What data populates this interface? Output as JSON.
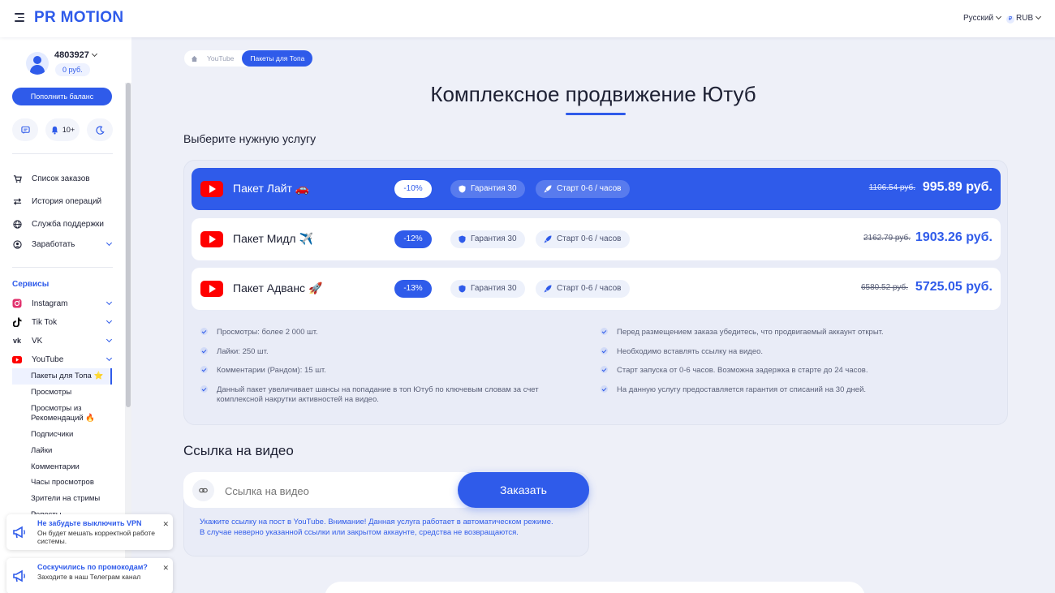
{
  "header": {
    "logo": "PR MOTION",
    "language": "Русский",
    "currency_symbol": "₽",
    "currency": "RUB"
  },
  "user": {
    "id": "4803927",
    "balance": "0 руб.",
    "topup_label": "Пополнить баланс",
    "notifications": "10+"
  },
  "sidebar": {
    "nav": [
      {
        "label": "Список заказов",
        "icon": "cart-icon"
      },
      {
        "label": "История операций",
        "icon": "transfer-icon"
      },
      {
        "label": "Служба поддержки",
        "icon": "globe-icon"
      },
      {
        "label": "Заработать",
        "icon": "user-circle-icon"
      }
    ],
    "services_title": "Сервисы",
    "services": [
      {
        "label": "Instagram",
        "icon": "instagram-icon"
      },
      {
        "label": "Tik Tok",
        "icon": "tiktok-icon"
      },
      {
        "label": "VK",
        "icon": "vk-icon"
      },
      {
        "label": "YouTube",
        "icon": "youtube-icon"
      }
    ],
    "youtube_sub": [
      "Пакеты для Топа ⭐",
      "Просмотры",
      "Просмотры из Рекомендаций 🔥",
      "Подписчики",
      "Лайки",
      "Комментарии",
      "Часы просмотров",
      "Зрители на стримы",
      "Репосты"
    ]
  },
  "toasts": [
    {
      "title": "Не забудьте выключить VPN",
      "text": "Он будет мешать корректной работе системы."
    },
    {
      "title": "Соскучились по промокодам?",
      "text": "Заходите в наш Телеграм канал"
    }
  ],
  "breadcrumb": {
    "parent": "YouTube",
    "current": "Пакеты для Топа"
  },
  "page_title": "Комплексное продвижение Ютуб",
  "choose_title": "Выберите нужную услугу",
  "packages": [
    {
      "name": "Пакет Лайт 🚗",
      "discount": "-10%",
      "guarantee": "Гарантия 30",
      "start": "Старт 0-6 / часов",
      "old_price": "1106.54 руб.",
      "price": "995.89 руб.",
      "active": true
    },
    {
      "name": "Пакет Мидл ✈️",
      "discount": "-12%",
      "guarantee": "Гарантия 30",
      "start": "Старт 0-6 / часов",
      "old_price": "2162.79 руб.",
      "price": "1903.26 руб.",
      "active": false
    },
    {
      "name": "Пакет Адванс 🚀",
      "discount": "-13%",
      "guarantee": "Гарантия 30",
      "start": "Старт 0-6 / часов",
      "old_price": "6580.52 руб.",
      "price": "5725.05 руб.",
      "active": false
    }
  ],
  "features_left": [
    "Просмотры: более 2 000 шт.",
    "Лайки: 250 шт.",
    "Комментарии (Рандом): 15 шт.",
    "Данный пакет увеличивает шансы на попадание в топ Ютуб по ключевым словам за счет комплексной накрутки активностей на видео."
  ],
  "features_right": [
    "Перед размещением заказа убедитесь, что продвигаемый аккаунт открыт.",
    "Необходимо вставлять ссылку на видео.",
    "Старт запуска от 0-6 часов. Возможна задержка в старте до 24 часов.",
    "На данную услугу предоставляется гарантия от списаний на 30 дней."
  ],
  "link_section": {
    "title": "Ссылка на видео",
    "placeholder": "Ссылка на видео",
    "order_label": "Заказать",
    "note": "Укажите ссылку на пост в YouTube. Внимание! Данная услуга работает в автоматическом режиме. В случае неверно указанной ссылки или закрытом аккаунте, средства не возвращаются."
  },
  "colors": {
    "accent": "#2f5bea",
    "youtube": "#ff0000",
    "background": "#eef0f8"
  }
}
